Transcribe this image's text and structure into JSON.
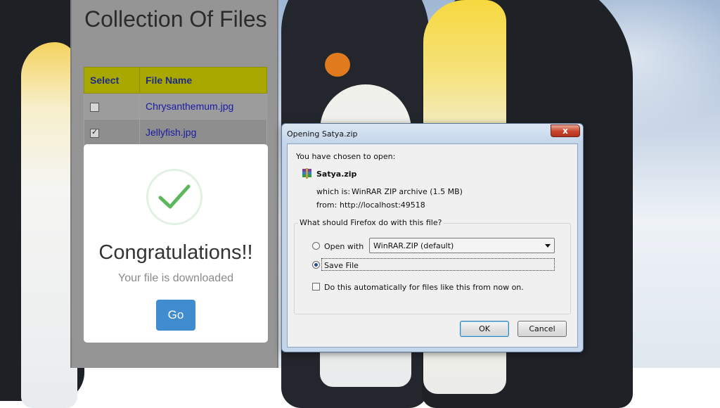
{
  "web_page": {
    "title": "Collection Of Files",
    "table": {
      "headers": [
        "Select",
        "File Name"
      ],
      "rows": [
        {
          "checked": false,
          "file_name": "Chrysanthemum.jpg"
        },
        {
          "checked": true,
          "file_name": "Jellyfish.jpg"
        }
      ]
    },
    "modal": {
      "title": "Congratulations!!",
      "message": "Your file is downloaded",
      "button_label": "Go"
    }
  },
  "dialog": {
    "title": "Opening Satya.zip",
    "close_label": "x",
    "intro": "You have chosen to open:",
    "file_name": "Satya.zip",
    "which_is_label": "which is:",
    "which_is_value": "WinRAR ZIP archive (1.5 MB)",
    "from_label": "from:",
    "from_value": "http://localhost:49518",
    "question": "What should Firefox do with this file?",
    "open_with_label": "Open with",
    "open_with_app": "WinRAR.ZIP (default)",
    "save_file_label": "Save File",
    "selected_option": "save_file",
    "auto_label": "Do this automatically for files like this from now on.",
    "auto_checked": false,
    "ok_label": "OK",
    "cancel_label": "Cancel"
  },
  "icons": {
    "success": "check-circle-icon",
    "archive": "winrar-archive-icon",
    "dropdown": "chevron-down-icon",
    "close": "close-icon"
  },
  "colors": {
    "table_header_bg": "#a8a800",
    "link": "#1a1aa8",
    "go_button": "#3f8ccf",
    "success_check": "#5cb85c"
  }
}
